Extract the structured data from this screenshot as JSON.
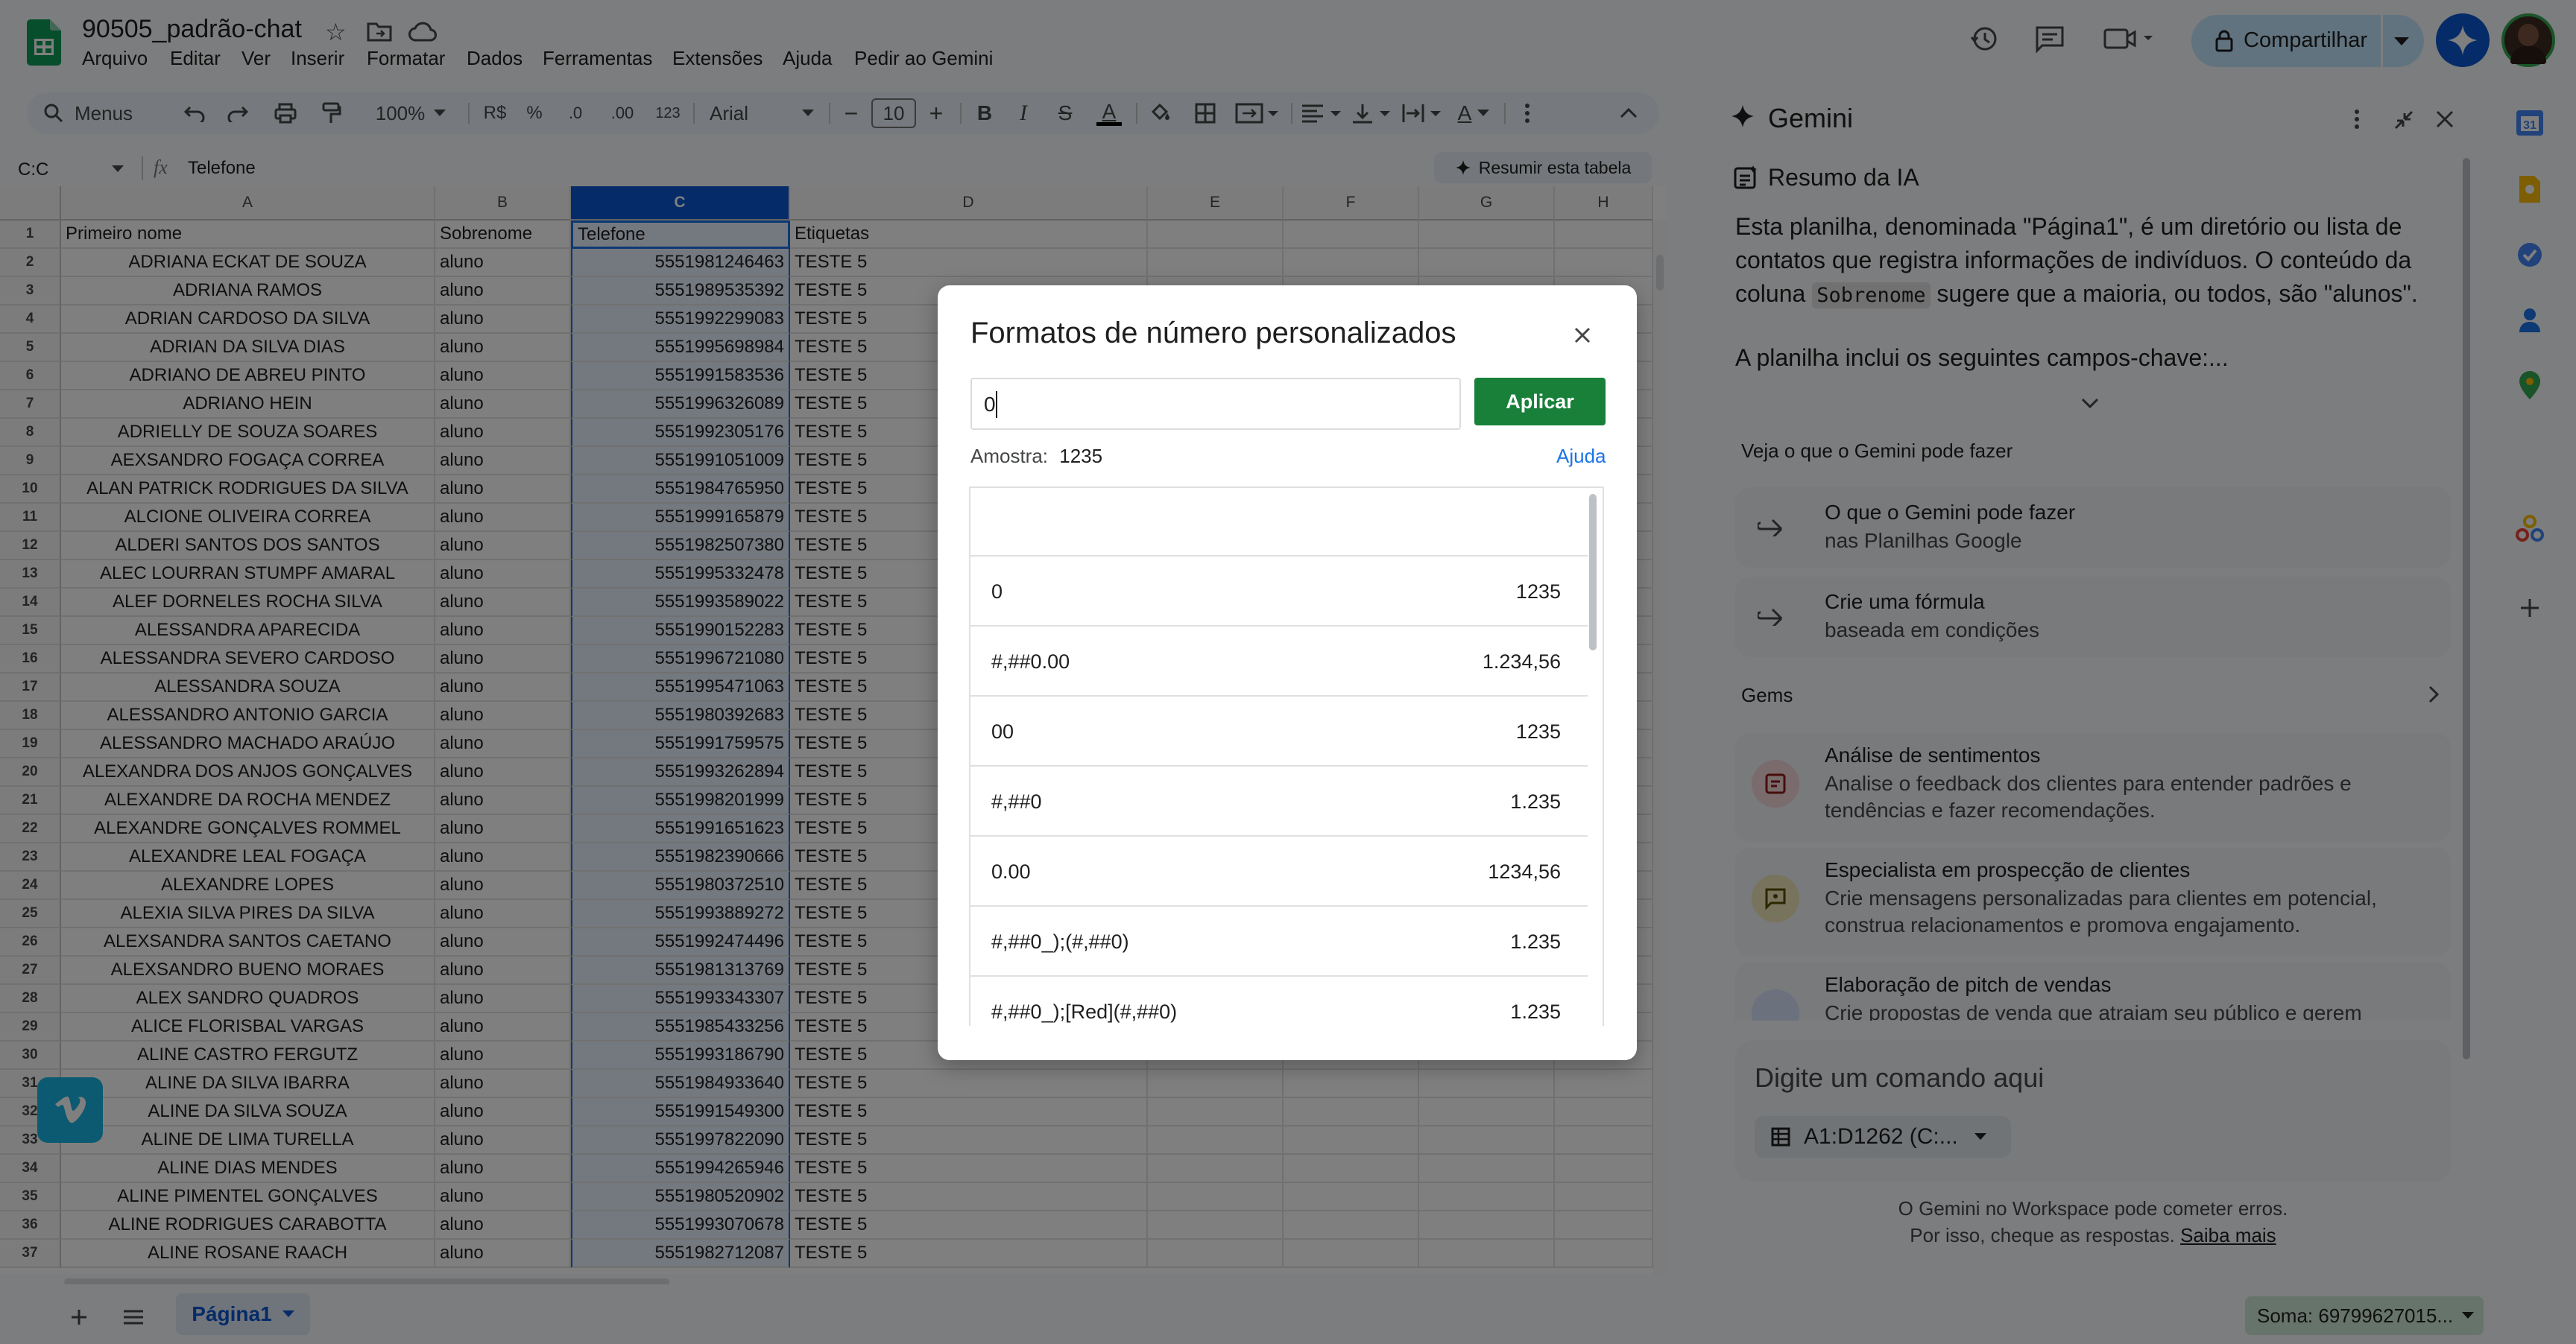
{
  "doc": {
    "title": "90505_padrão-chat",
    "menus": [
      "Arquivo",
      "Editar",
      "Ver",
      "Inserir",
      "Formatar",
      "Dados",
      "Ferramentas",
      "Extensões",
      "Ajuda",
      "Pedir ao Gemini"
    ],
    "share_label": "Compartilhar"
  },
  "toolbar": {
    "search_label": "Menus",
    "zoom": "100%",
    "currency": "R$",
    "percent": "%",
    "dec_minus": ".0",
    "dec_plus": ".00",
    "more_formats": "123",
    "font": "Arial",
    "font_size": "10",
    "bold": "B",
    "italic": "I",
    "strike": "S",
    "textcolor": "A",
    "textrot": "A"
  },
  "formula": {
    "name_box": "C:C",
    "fx": "fx",
    "content": "Telefone",
    "summarize": "Resumir esta tabela"
  },
  "sheet": {
    "columns": [
      "A",
      "B",
      "C",
      "D",
      "E",
      "F",
      "G",
      "H"
    ],
    "rows": [
      [
        "Primeiro nome",
        "Sobrenome",
        "Telefone",
        "Etiquetas"
      ],
      [
        "ADRIANA ECKAT DE SOUZA",
        "aluno",
        "5551981246463",
        "TESTE 5"
      ],
      [
        "ADRIANA RAMOS",
        "aluno",
        "5551989535392",
        "TESTE 5"
      ],
      [
        "ADRIAN CARDOSO DA SILVA",
        "aluno",
        "5551992299083",
        "TESTE 5"
      ],
      [
        "ADRIAN DA SILVA DIAS",
        "aluno",
        "5551995698984",
        "TESTE 5"
      ],
      [
        "ADRIANO DE ABREU PINTO",
        "aluno",
        "5551991583536",
        "TESTE 5"
      ],
      [
        "ADRIANO HEIN",
        "aluno",
        "5551996326089",
        "TESTE 5"
      ],
      [
        "ADRIELLY DE SOUZA SOARES",
        "aluno",
        "5551992305176",
        "TESTE 5"
      ],
      [
        "AEXSANDRO FOGAÇA CORREA",
        "aluno",
        "5551991051009",
        "TESTE 5"
      ],
      [
        "ALAN PATRICK RODRIGUES DA SILVA",
        "aluno",
        "5551984765950",
        "TESTE 5"
      ],
      [
        "ALCIONE OLIVEIRA CORREA",
        "aluno",
        "5551999165879",
        "TESTE 5"
      ],
      [
        "ALDERI SANTOS DOS SANTOS",
        "aluno",
        "5551982507380",
        "TESTE 5"
      ],
      [
        "ALEC LOURRAN STUMPF AMARAL",
        "aluno",
        "5551995332478",
        "TESTE 5"
      ],
      [
        "ALEF DORNELES ROCHA SILVA",
        "aluno",
        "5551993589022",
        "TESTE 5"
      ],
      [
        "ALESSANDRA APARECIDA",
        "aluno",
        "5551990152283",
        "TESTE 5"
      ],
      [
        "ALESSANDRA SEVERO CARDOSO",
        "aluno",
        "5551996721080",
        "TESTE 5"
      ],
      [
        "ALESSANDRA SOUZA",
        "aluno",
        "5551995471063",
        "TESTE 5"
      ],
      [
        "ALESSANDRO ANTONIO GARCIA",
        "aluno",
        "5551980392683",
        "TESTE 5"
      ],
      [
        "ALESSANDRO MACHADO ARAÚJO",
        "aluno",
        "5551991759575",
        "TESTE 5"
      ],
      [
        "ALEXANDRA DOS ANJOS GONÇALVES",
        "aluno",
        "5551993262894",
        "TESTE 5"
      ],
      [
        "ALEXANDRE DA ROCHA MENDEZ",
        "aluno",
        "5551998201999",
        "TESTE 5"
      ],
      [
        "ALEXANDRE GONÇALVES ROMMEL",
        "aluno",
        "5551991651623",
        "TESTE 5"
      ],
      [
        "ALEXANDRE LEAL FOGAÇA",
        "aluno",
        "5551982390666",
        "TESTE 5"
      ],
      [
        "ALEXANDRE LOPES",
        "aluno",
        "5551980372510",
        "TESTE 5"
      ],
      [
        "ALEXIA SILVA PIRES DA SILVA",
        "aluno",
        "5551993889272",
        "TESTE 5"
      ],
      [
        "ALEXSANDRA SANTOS CAETANO",
        "aluno",
        "5551992474496",
        "TESTE 5"
      ],
      [
        "ALEXSANDRO BUENO MORAES",
        "aluno",
        "5551981313769",
        "TESTE 5"
      ],
      [
        "ALEX SANDRO QUADROS",
        "aluno",
        "5551993343307",
        "TESTE 5"
      ],
      [
        "ALICE FLORISBAL VARGAS",
        "aluno",
        "5551985433256",
        "TESTE 5"
      ],
      [
        "ALINE CASTRO FERGUTZ",
        "aluno",
        "5551993186790",
        "TESTE 5"
      ],
      [
        "ALINE DA SILVA IBARRA",
        "aluno",
        "5551984933640",
        "TESTE 5"
      ],
      [
        "ALINE DA SILVA SOUZA",
        "aluno",
        "5551991549300",
        "TESTE 5"
      ],
      [
        "ALINE DE LIMA TURELLA",
        "aluno",
        "5551997822090",
        "TESTE 5"
      ],
      [
        "ALINE DIAS MENDES",
        "aluno",
        "5551994265946",
        "TESTE 5"
      ],
      [
        "ALINE PIMENTEL GONÇALVES",
        "aluno",
        "5551980520902",
        "TESTE 5"
      ],
      [
        "ALINE RODRIGUES CARABOTTA",
        "aluno",
        "5551993070678",
        "TESTE 5"
      ],
      [
        "ALINE ROSANE RAACH",
        "aluno",
        "5551982712087",
        "TESTE 5"
      ]
    ]
  },
  "dialog": {
    "title": "Formatos de número personalizados",
    "input_value": "0",
    "apply_label": "Aplicar",
    "sample_label": "Amostra:",
    "sample_value": "1235",
    "help_label": "Ajuda",
    "formats": [
      {
        "pattern": "0",
        "example": "1235"
      },
      {
        "pattern": "#,##0.00",
        "example": "1.234,56"
      },
      {
        "pattern": "00",
        "example": "1235"
      },
      {
        "pattern": "#,##0",
        "example": "1.235"
      },
      {
        "pattern": "0.00",
        "example": "1234,56"
      },
      {
        "pattern": "#,##0_);(#,##0)",
        "example": "1.235"
      },
      {
        "pattern": "#,##0_);[Red](#,##0)",
        "example": "1.235"
      }
    ]
  },
  "gemini": {
    "title": "Gemini",
    "summary_title": "Resumo da IA",
    "summary_text_1": "Esta planilha, denominada \"Página1\", é um diretório ou lista de contatos que registra informações de indivíduos. O conteúdo da coluna",
    "summary_code": "Sobrenome",
    "summary_text_2": "sugere que a maioria, ou todos, são \"alunos\".",
    "summary_text_3": "A planilha inclui os seguintes campos-chave:...",
    "section_label": "Veja o que o Gemini pode fazer",
    "suggestions": [
      {
        "title": "O que o Gemini pode fazer",
        "sub": "nas Planilhas Google"
      },
      {
        "title": "Crie uma fórmula",
        "sub": "baseada em condições"
      }
    ],
    "gems_label": "Gems",
    "gems": [
      {
        "title": "Análise de sentimentos",
        "sub": "Analise o feedback dos clientes para entender padrões e tendências e fazer recomendações."
      },
      {
        "title": "Especialista em prospecção de clientes",
        "sub": "Crie mensagens personalizadas para clientes em potencial, construa relacionamentos e promova engajamento."
      },
      {
        "title": "Elaboração de pitch de vendas",
        "sub": "Crie propostas de venda que atraiam seu público e gerem"
      }
    ],
    "prompt_placeholder": "Digite um comando aqui",
    "range_chip": "A1:D1262 (C:...",
    "disclaimer_1": "O Gemini no Workspace pode cometer erros.",
    "disclaimer_2": "Por isso, cheque as respostas.",
    "learn_more": "Saiba mais"
  },
  "bottom": {
    "sheet_tab": "Página1",
    "sum": "Soma: 69799627015..."
  },
  "colors": {
    "sheets_green": "#0f9d58",
    "apply_green": "#188038",
    "selection_blue": "#1a73e8",
    "share_bg": "#c2e7ff"
  }
}
